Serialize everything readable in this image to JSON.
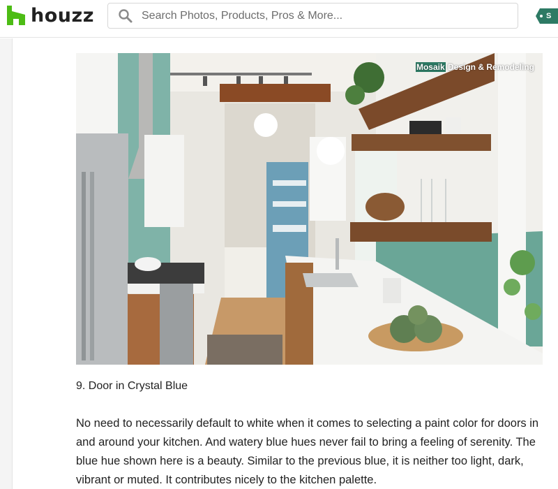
{
  "header": {
    "brand": "houzz",
    "search_placeholder": "Search Photos, Products, Pros & More...",
    "signup_label": "S",
    "brand_color": "#4dbc15",
    "accent_color": "#2d7a64"
  },
  "photo": {
    "credit_highlight": "Mosaik",
    "credit_rest": " Design & Remodeling"
  },
  "article": {
    "heading": "9. Door in Crystal Blue",
    "body": "No need to necessarily default to white when it comes to selecting a paint color for doors in and around your kitchen. And watery blue hues never fail to bring a feeling of serenity. The blue hue shown here is a beauty. Similar to the previous blue, it is neither too light, dark, vibrant or muted. It contributes nicely to the kitchen palette."
  }
}
